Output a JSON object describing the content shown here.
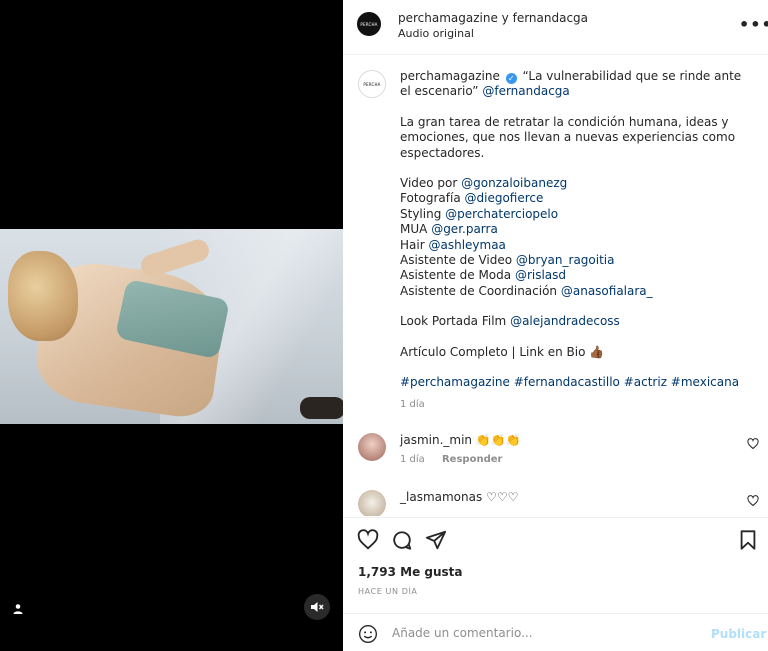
{
  "post": {
    "header": {
      "title": "perchamagazine y fernandacga",
      "subtitle": "Audio original",
      "avatar_text": "PERCHA"
    },
    "caption": {
      "avatar_text": "PERCHA",
      "username": "perchamagazine",
      "quote": "“La vulnerabilidad que se rinde ante el escenario”",
      "mention": "@fernandacga",
      "paragraph": "La gran tarea de retratar la condición humana, ideas y emociones, que nos llevan a nuevas experiencias como espectadores.",
      "credits": [
        {
          "label": "Video por",
          "handle": "@gonzaloibanezg"
        },
        {
          "label": "Fotografía",
          "handle": "@diegofierce"
        },
        {
          "label": "Styling",
          "handle": "@perchaterciopelo"
        },
        {
          "label": "MUA",
          "handle": "@ger.parra"
        },
        {
          "label": "Hair",
          "handle": "@ashleymaa"
        },
        {
          "label": "Asistente de Video",
          "handle": "@bryan_ragoitia"
        },
        {
          "label": "Asistente de Moda",
          "handle": "@rislasd"
        },
        {
          "label": "Asistente de Coordinación",
          "handle": "@anasofialara_"
        }
      ],
      "look": {
        "label": "Look Portada Film",
        "handle": "@alejandradecoss"
      },
      "article": "Artículo Completo | Link en Bio 👍🏾",
      "hashtags": "#perchamagazine #fernandacastillo #actriz #mexicana",
      "time": "1 día"
    },
    "comments": [
      {
        "username": "jasmin._min",
        "text": "👏👏👏",
        "time": "1 día",
        "reply": "Responder"
      },
      {
        "username": "_lasmamonas",
        "text": "♡♡♡"
      }
    ],
    "likes": "1,793 Me gusta",
    "ago": "Hace un día",
    "add_comment": {
      "placeholder": "Añade un comentario...",
      "publish": "Publicar"
    }
  },
  "icons": {
    "more": "more-options-icon",
    "like": "heart-icon",
    "comment": "comment-icon",
    "share": "share-icon",
    "save": "bookmark-icon",
    "emoji": "emoji-icon",
    "mute": "muted-speaker-icon",
    "tagged": "tagged-user-icon"
  },
  "colors": {
    "link": "#00376b",
    "muted": "#8e8e8e",
    "publish": "#b2dffc",
    "verified": "#3897f0"
  }
}
